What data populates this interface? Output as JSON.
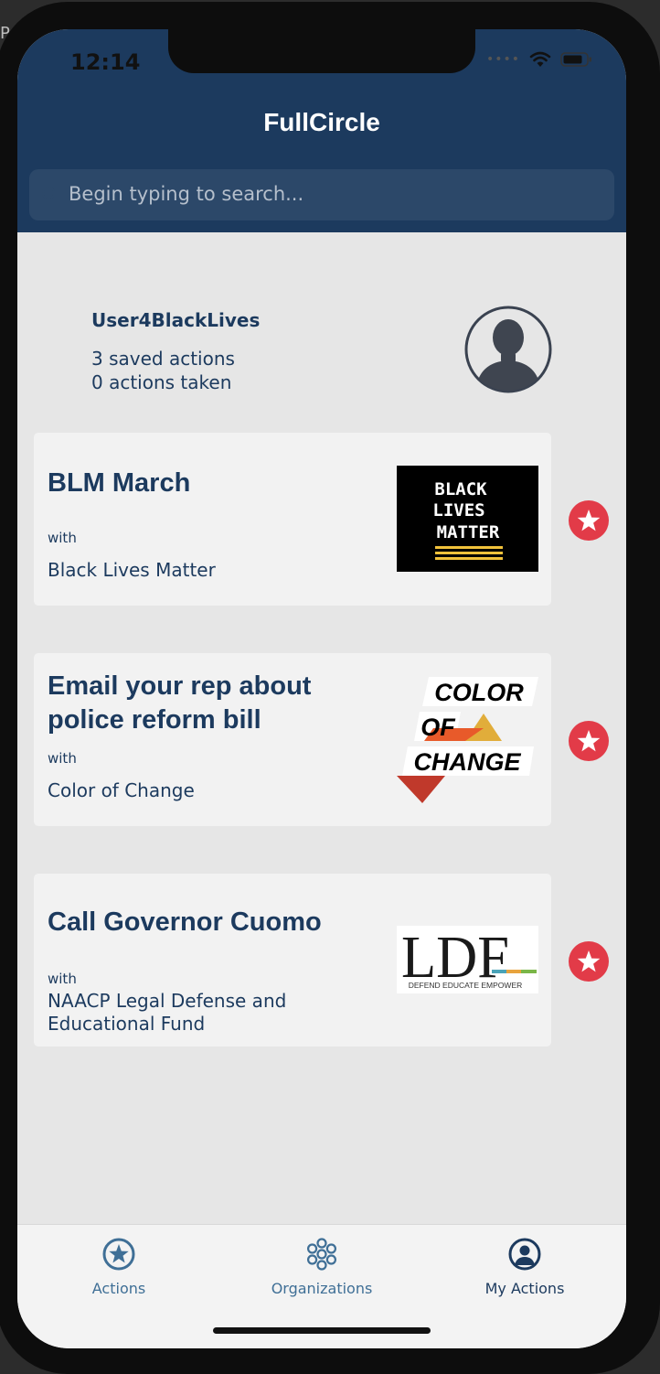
{
  "device": {
    "time": "12:14"
  },
  "app": {
    "title": "FullCircle"
  },
  "search": {
    "placeholder": "Begin typing to search..."
  },
  "profile": {
    "username": "User4BlackLives",
    "saved_actions": "3 saved actions",
    "actions_taken": "0 actions taken"
  },
  "actions": [
    {
      "title": "BLM March",
      "with_label": "with",
      "organization": "Black Lives Matter",
      "logo": {
        "line1": "BLACK",
        "line2": "LIVES",
        "line3": "MATTER"
      },
      "starred": true
    },
    {
      "title": "Email your rep about police reform bill",
      "with_label": "with",
      "organization": "Color of Change",
      "logo": {
        "line1": "COLOR",
        "line2": "OF",
        "line3": "CHANGE"
      },
      "starred": true
    },
    {
      "title": "Call Governor Cuomo",
      "with_label": "with",
      "organization": "NAACP Legal Defense and Educational Fund",
      "logo": {
        "mark": "LDF",
        "tagline": "DEFEND EDUCATE EMPOWER"
      },
      "starred": true
    }
  ],
  "tabs": [
    {
      "label": "Actions",
      "icon": "star-circle-icon",
      "active": false
    },
    {
      "label": "Organizations",
      "icon": "organizations-icon",
      "active": false
    },
    {
      "label": "My Actions",
      "icon": "user-circle-icon",
      "active": true
    }
  ],
  "colors": {
    "header": "#1c3a5e",
    "accent": "#e23b48",
    "tab_inactive": "#3f6f96",
    "tab_active": "#1c3a5e"
  }
}
